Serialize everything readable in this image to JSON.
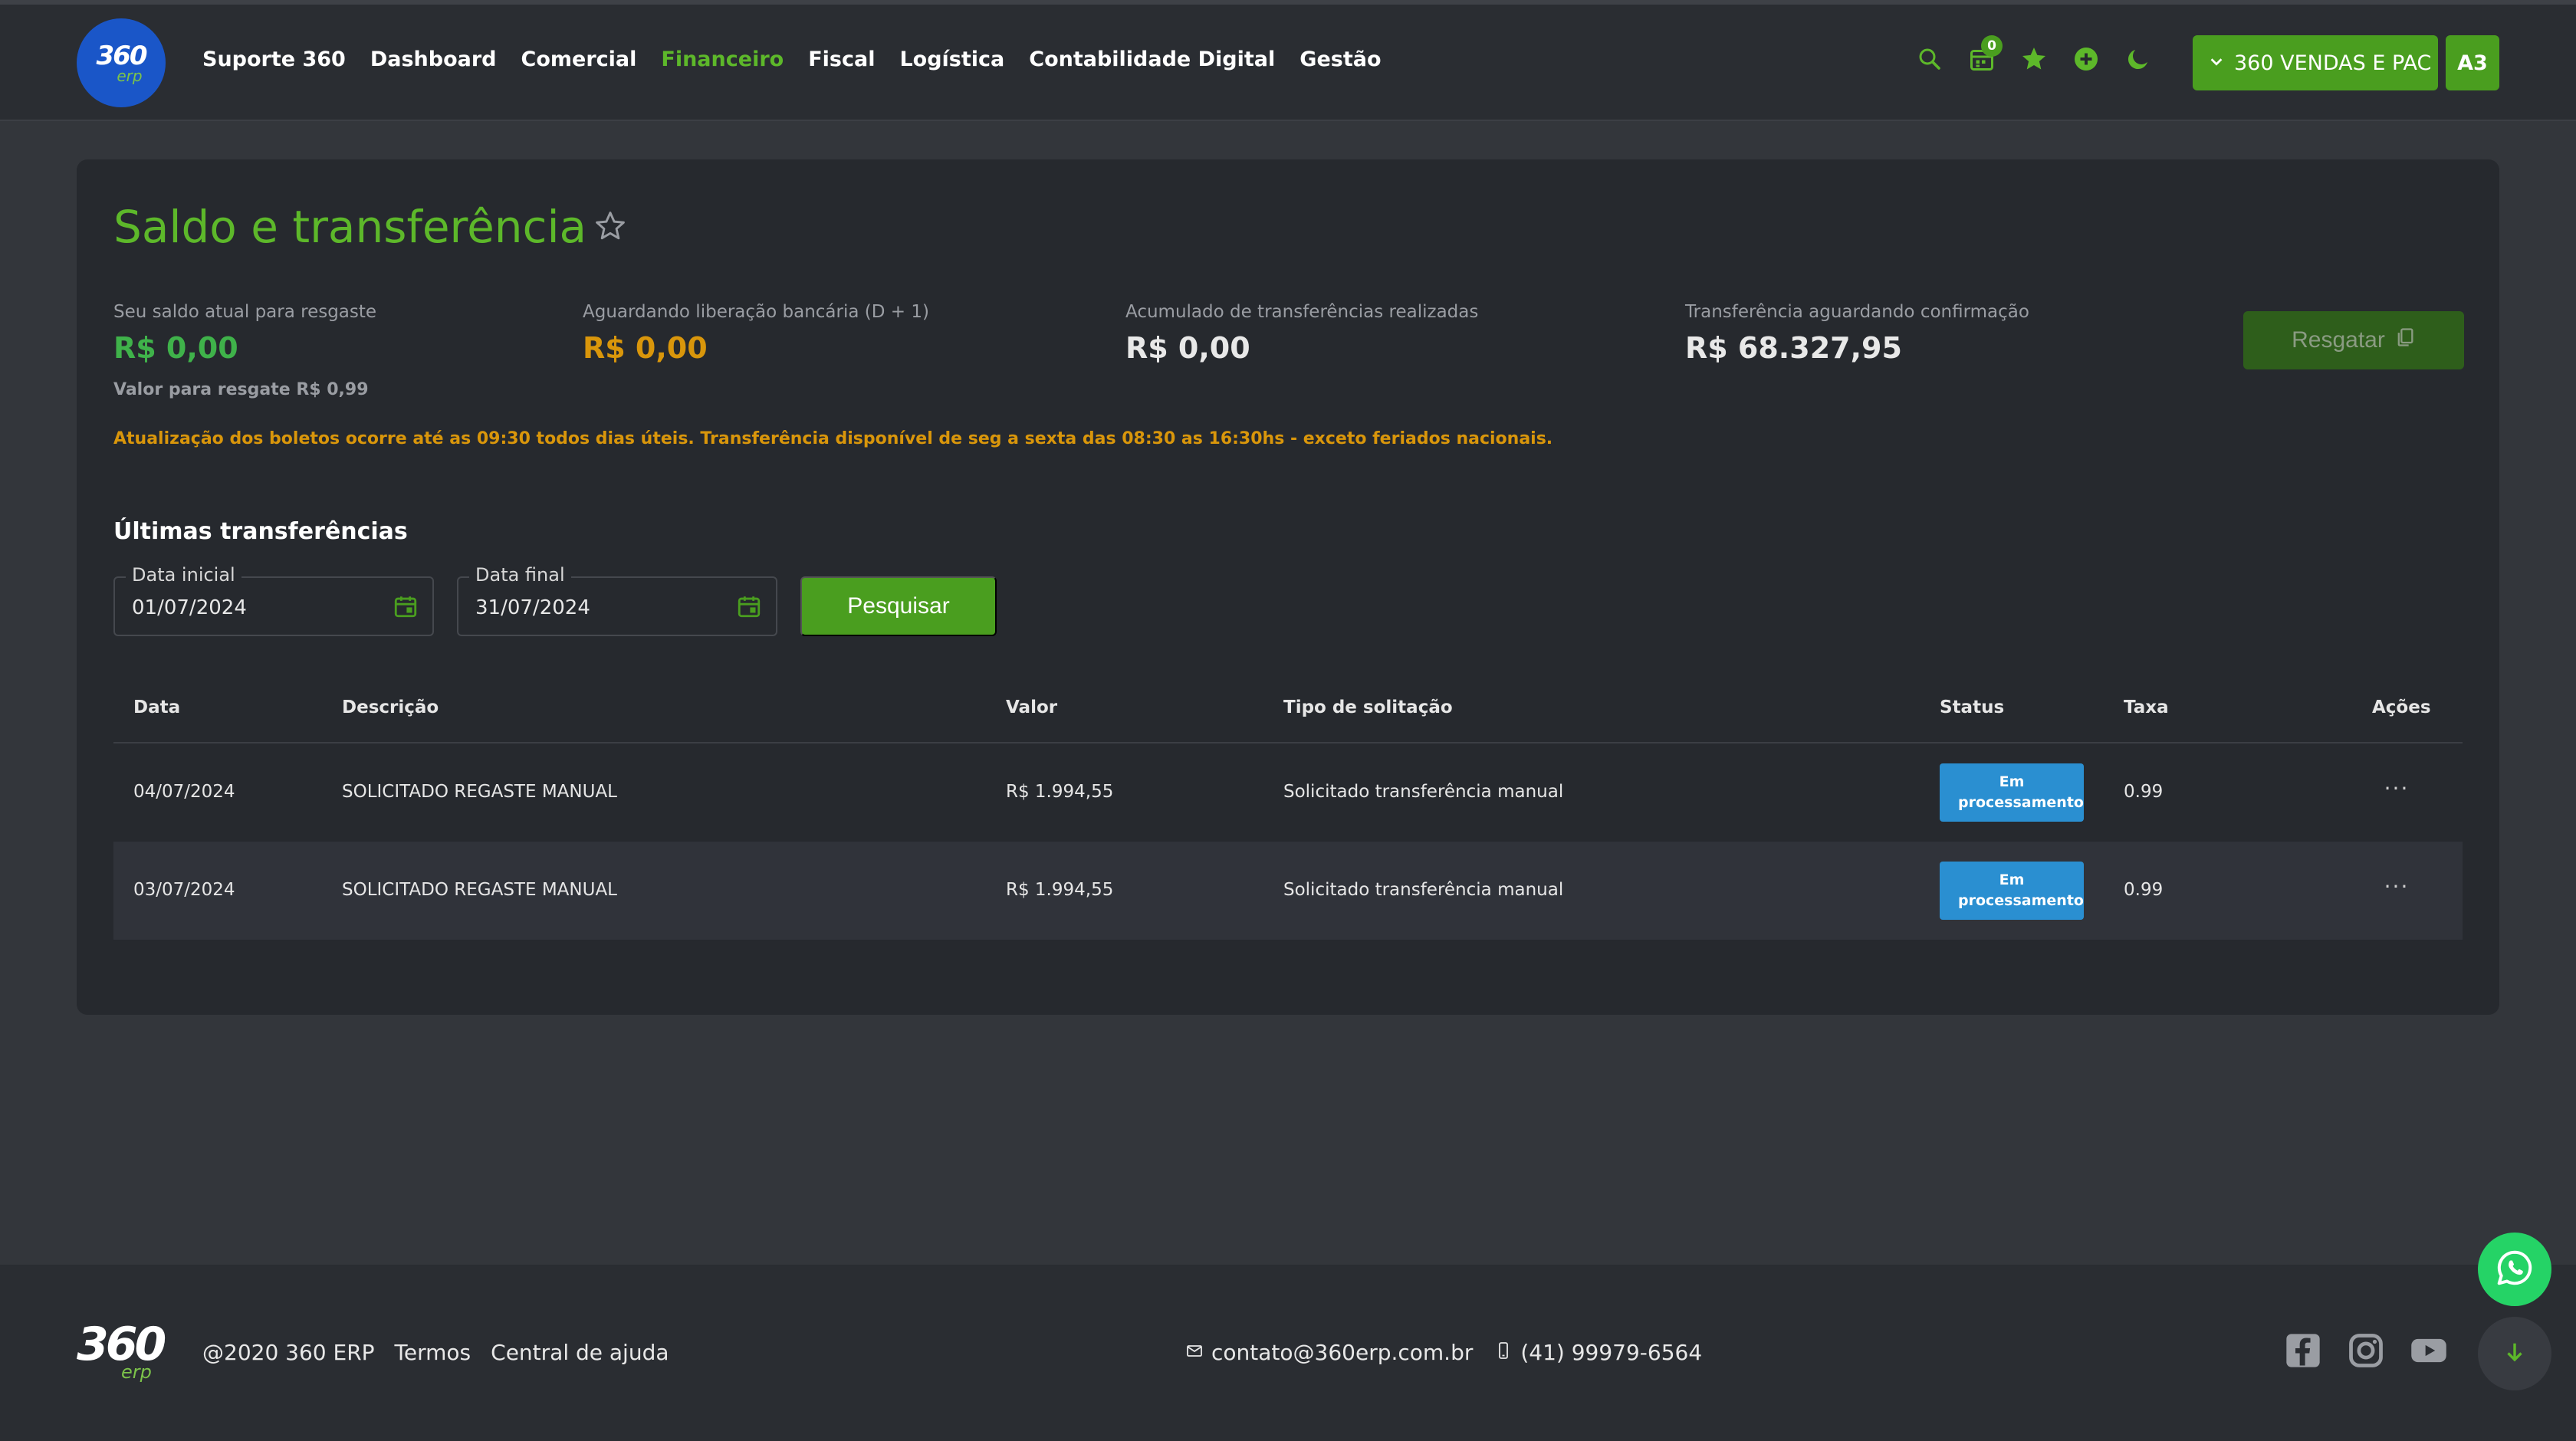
{
  "header": {
    "logo_text": "360",
    "logo_sub": "erp",
    "nav": [
      {
        "label": "Suporte 360",
        "active": false
      },
      {
        "label": "Dashboard",
        "active": false
      },
      {
        "label": "Comercial",
        "active": false
      },
      {
        "label": "Financeiro",
        "active": true
      },
      {
        "label": "Fiscal",
        "active": false
      },
      {
        "label": "Logística",
        "active": false
      },
      {
        "label": "Contabilidade Digital",
        "active": false
      },
      {
        "label": "Gestão",
        "active": false
      }
    ],
    "icons": [
      "search-icon",
      "calendar-icon",
      "star-icon",
      "add-circle-icon",
      "moon-icon"
    ],
    "calendar_badge": "0",
    "company_label": "360 VENDAS E PAC",
    "avatar_initials": "A3"
  },
  "page": {
    "title": "Saldo e transferência",
    "stats": [
      {
        "label": "Seu saldo atual para resgaste",
        "value": "R$ 0,00",
        "color": "#3fb24a"
      },
      {
        "label": "Aguardando liberação bancária (D + 1)",
        "value": "R$ 0,00",
        "color": "#d9960b"
      },
      {
        "label": "Acumulado de transferências realizadas",
        "value": "R$ 0,00",
        "color": "#e8e8e8"
      },
      {
        "label": "Transferência aguardando confirmação",
        "value": "R$ 68.327,95",
        "color": "#e8e8e8"
      }
    ],
    "sub_note": "Valor para resgate R$ 0,99",
    "warning": "Atualização dos boletos ocorre até as 09:30 todos dias úteis. Transferência disponível de seg a sexta das 08:30 as 16:30hs - exceto feriados nacionais.",
    "resgatar_label": "Resgatar",
    "section_title": "Últimas transferências",
    "filters": {
      "start_label": "Data inicial",
      "start_value": "01/07/2024",
      "end_label": "Data final",
      "end_value": "31/07/2024",
      "search_label": "Pesquisar"
    },
    "table": {
      "headers": [
        "Data",
        "Descrição",
        "Valor",
        "Tipo de solitação",
        "Status",
        "Taxa",
        "Ações"
      ],
      "rows": [
        {
          "date": "04/07/2024",
          "desc": "SOLICITADO REGASTE MANUAL",
          "value": "R$ 1.994,55",
          "type": "Solicitado transferência manual",
          "status": "Em processamento",
          "fee": "0.99"
        },
        {
          "date": "03/07/2024",
          "desc": "SOLICITADO REGASTE MANUAL",
          "value": "R$ 1.994,55",
          "type": "Solicitado transferência manual",
          "status": "Em processamento",
          "fee": "0.99"
        }
      ]
    }
  },
  "footer": {
    "logo_text": "360",
    "logo_sub": "erp",
    "copyright": "@2020 360 ERP",
    "terms": "Termos",
    "help": "Central de ajuda",
    "email": "contato@360erp.com.br",
    "phone": "(41) 99979-6564",
    "social": [
      "facebook-icon",
      "instagram-icon",
      "youtube-icon"
    ]
  },
  "colors": {
    "accent": "#5db82a",
    "button_green": "#4a9e1f",
    "status_blue": "#2a8fd1",
    "warning": "#d9960b"
  }
}
